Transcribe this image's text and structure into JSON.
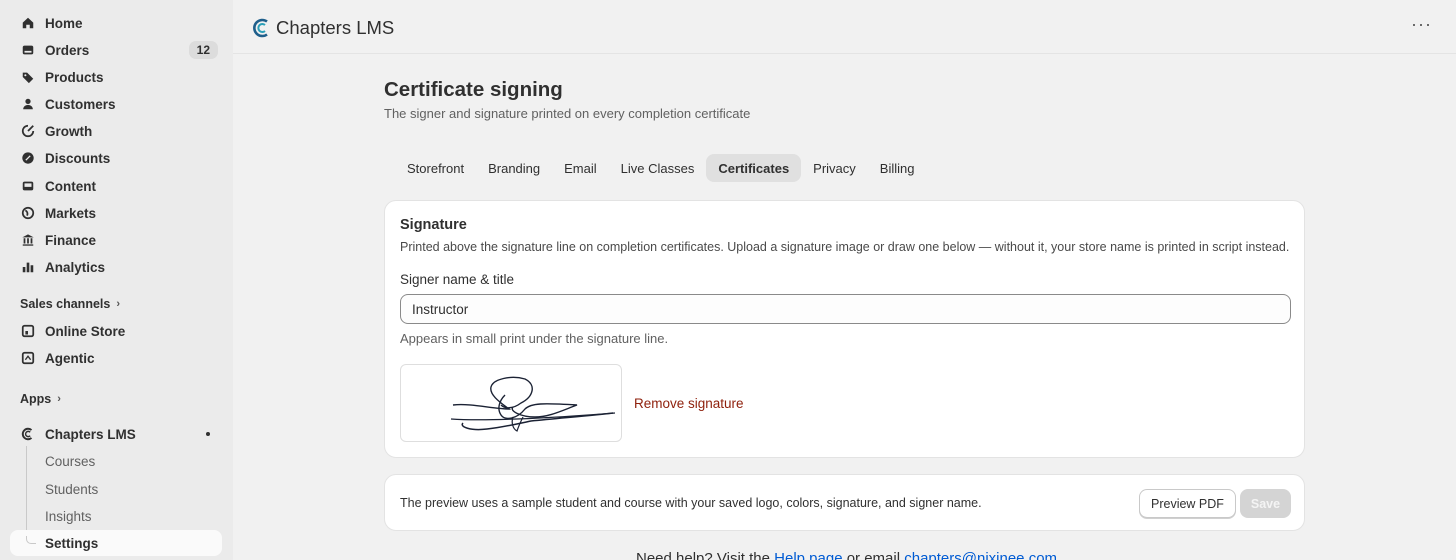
{
  "sidebar": {
    "items": [
      {
        "label": "Home",
        "icon": "home-icon"
      },
      {
        "label": "Orders",
        "icon": "orders-icon",
        "badge": "12"
      },
      {
        "label": "Products",
        "icon": "tag-icon"
      },
      {
        "label": "Customers",
        "icon": "person-icon"
      },
      {
        "label": "Growth",
        "icon": "growth-icon"
      },
      {
        "label": "Discounts",
        "icon": "discount-icon"
      },
      {
        "label": "Content",
        "icon": "content-icon"
      },
      {
        "label": "Markets",
        "icon": "globe-icon"
      },
      {
        "label": "Finance",
        "icon": "bank-icon"
      },
      {
        "label": "Analytics",
        "icon": "bar-chart-icon"
      }
    ],
    "sales_channels_label": "Sales channels",
    "channels": [
      {
        "label": "Online Store",
        "icon": "store-icon"
      },
      {
        "label": "Agentic",
        "icon": "agentic-icon"
      }
    ],
    "apps_label": "Apps",
    "app": {
      "label": "Chapters LMS",
      "icon": "chapters-logo-icon"
    },
    "app_subitems": [
      {
        "label": "Courses"
      },
      {
        "label": "Students"
      },
      {
        "label": "Insights"
      },
      {
        "label": "Settings"
      }
    ]
  },
  "topbar": {
    "app_name": "Chapters LMS",
    "more_label": "···"
  },
  "page": {
    "title": "Certificate signing",
    "subtitle": "The signer and signature printed on every completion certificate"
  },
  "tabs": [
    "Storefront",
    "Branding",
    "Email",
    "Live Classes",
    "Certificates",
    "Privacy",
    "Billing"
  ],
  "active_tab": "Certificates",
  "signature_card": {
    "title": "Signature",
    "description": "Printed above the signature line on completion certificates. Upload a signature image or draw one below — without it, your store name is printed in script instead.",
    "field_label": "Signer name & title",
    "field_value": "Instructor",
    "help_text": "Appears in small print under the signature line.",
    "remove_label": "Remove signature"
  },
  "preview_card": {
    "text": "The preview uses a sample student and course with your saved logo, colors, signature, and signer name.",
    "preview_button": "Preview PDF",
    "save_button": "Save"
  },
  "footer": {
    "prefix": "Need help? Visit the ",
    "help_link": "Help page",
    "middle": " or email ",
    "email": "chapters@nixinee.com"
  },
  "colors": {
    "accent_link": "#005bd3",
    "destructive": "#8e1f0b",
    "active_tab_bg": "#e0e0e0"
  }
}
